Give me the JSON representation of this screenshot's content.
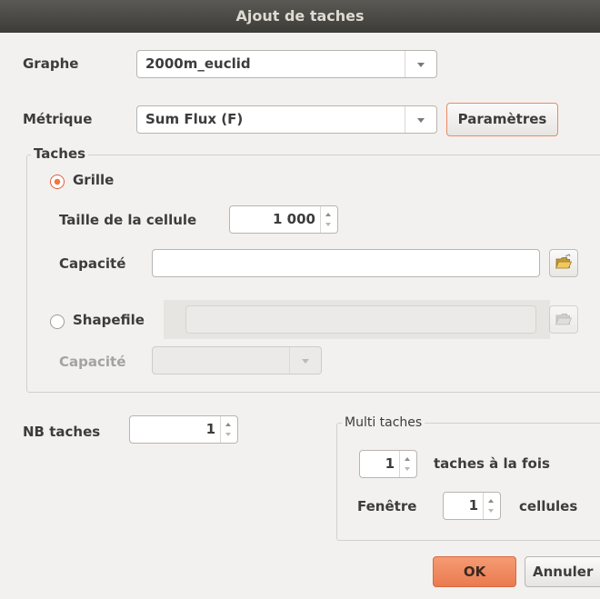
{
  "window": {
    "title": "Ajout de taches"
  },
  "graphe": {
    "label": "Graphe",
    "value": "2000m_euclid"
  },
  "metrique": {
    "label": "Métrique",
    "value": "Sum Flux (F)",
    "params_button": "Paramètres"
  },
  "taches": {
    "title": "Taches",
    "grille": {
      "label": "Grille",
      "selected": true,
      "taille_label": "Taille de la cellule",
      "taille_value": "1 000",
      "capacite_label": "Capacité",
      "capacite_value": ""
    },
    "shapefile": {
      "label": "Shapefile",
      "selected": false,
      "path_value": "",
      "capacite_label": "Capacité",
      "capacite_value": ""
    }
  },
  "nb_taches": {
    "label": "NB taches",
    "value": "1"
  },
  "multi": {
    "title": "Multi taches",
    "per_time_value": "1",
    "per_time_label": "taches à la fois",
    "fenetre_label": "Fenêtre",
    "fenetre_value": "1",
    "cellules_label": "cellules"
  },
  "buttons": {
    "ok": "OK",
    "cancel": "Annuler"
  },
  "icons": {
    "folder": "folder-open-icon"
  },
  "colors": {
    "accent": "#f07746",
    "titlebar": "#3d3c38"
  }
}
